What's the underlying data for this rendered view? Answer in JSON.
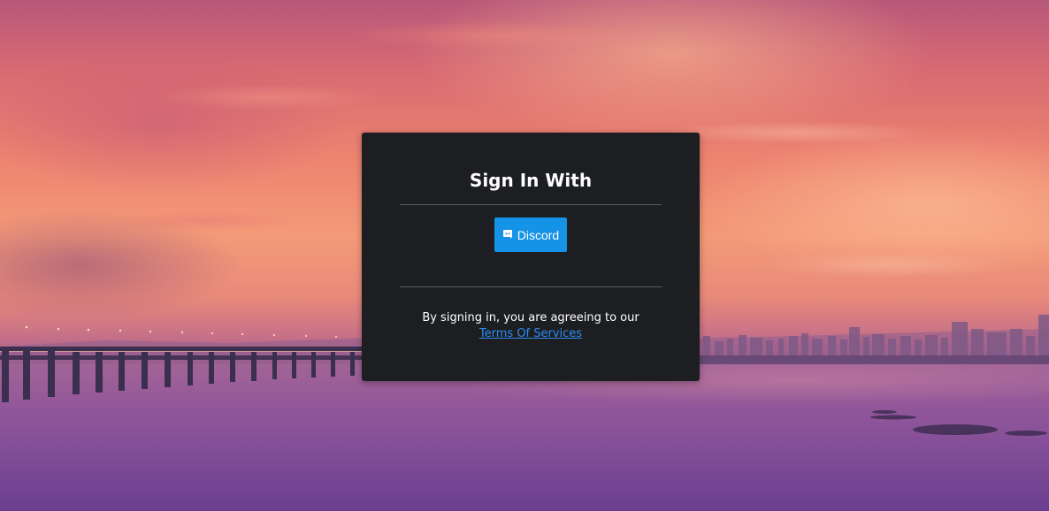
{
  "background": {
    "description_icon": "sunset-bridge-scene"
  },
  "card": {
    "title": "Sign In With",
    "discord_button": {
      "label": "Discord",
      "icon": "discord-icon",
      "color": "#1593e6"
    },
    "agreement_text": "By signing in, you are agreeing to our",
    "tos_link": "Terms Of Services",
    "background_color": "#1c1e22",
    "link_color": "#2d8cf0"
  }
}
